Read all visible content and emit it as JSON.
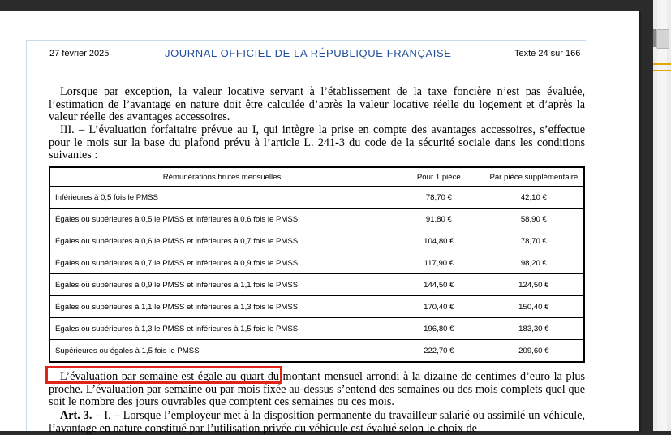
{
  "header": {
    "date": "27 février 2025",
    "journal": "JOURNAL OFFICIEL DE LA RÉPUBLIQUE FRANÇAISE",
    "texte": "Texte 24 sur 166"
  },
  "paragraphs": {
    "p1": "Lorsque par exception, la valeur locative servant à l’établissement de la taxe foncière n’est pas évaluée, l’estimation de l’avantage en nature doit être calculée d’après la valeur locative réelle du logement et d’après la valeur réelle des avantages accessoires.",
    "p2": "III. – L’évaluation forfaitaire prévue au I, qui intègre la prise en compte des avantages accessoires, s’effectue pour le mois sur la base du plafond prévu à l’article L. 241-3 du code de la sécurité sociale dans les conditions suivantes :",
    "p3": "L’évaluation par semaine est égale au quart du montant mensuel arrondi à la dizaine de centimes d’euro la plus proche. L’évaluation par semaine ou par mois fixée au-dessus s’entend des semaines ou des mois complets quel que soit le nombre des jours ouvrables que comptent ces semaines ou ces mois.",
    "p4_bold": "Art. 3. –",
    "p4": " I. – Lorsque l’employeur met à la disposition permanente du travailleur salarié ou assimilé un véhicule, l’avantage en nature constitué par l’utilisation privée du véhicule est évalué selon le choix de"
  },
  "table": {
    "headers": [
      "Rémunérations brutes mensuelles",
      "Pour 1 pièce",
      "Par pièce supplémentaire"
    ],
    "rows": [
      [
        "Inférieures à 0,5 fois le PMSS",
        "78,70 €",
        "42,10 €"
      ],
      [
        "Égales ou supérieures à 0,5 le PMSS et inférieures à 0,6 fois le PMSS",
        "91,80 €",
        "58,90 €"
      ],
      [
        "Égales ou supérieures à 0,6 le PMSS et inférieures à 0,7 fois le PMSS",
        "104,80 €",
        "78,70 €"
      ],
      [
        "Égales ou supérieures à 0,7 le PMSS et inférieures à 0,9 fois le PMSS",
        "117,90 €",
        "98,20 €"
      ],
      [
        "Égales ou supérieures à 0,9 le PMSS et inférieures à 1,1 fois le PMSS",
        "144,50 €",
        "124,50 €"
      ],
      [
        "Égales ou supérieures à 1,1 le PMSS et inférieures à 1,3 fois le PMSS",
        "170,40 €",
        "150,40 €"
      ],
      [
        "Égales ou supérieures à 1,3 le PMSS et inférieures à 1,5 fois le PMSS",
        "196,80 €",
        "183,30 €"
      ],
      [
        "Supérieures ou égales à 1,5 fois le PMSS",
        "222,70 €",
        "209,60 €"
      ]
    ]
  },
  "colors": {
    "journal_blue": "#1f4e9a",
    "highlight_red": "#e2231a",
    "viewer_bg": "#2b2b2b"
  }
}
